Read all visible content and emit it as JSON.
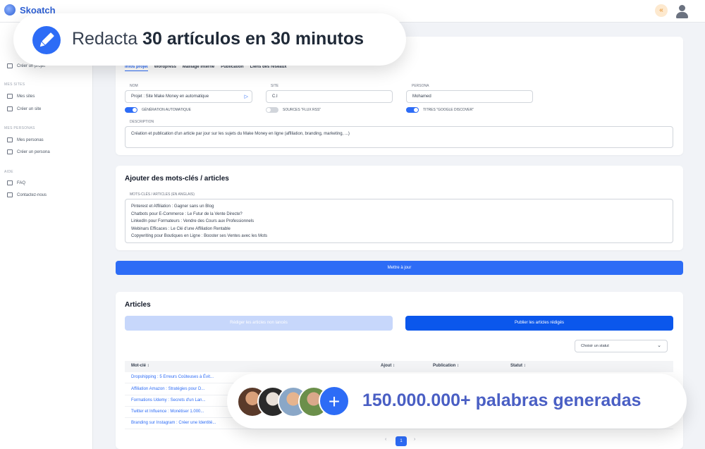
{
  "app": {
    "name": "Skoatch"
  },
  "sidebar": {
    "sections": [
      {
        "label": "MES SITES",
        "items": [
          {
            "label": "Mes sites"
          },
          {
            "label": "Créer un site"
          }
        ]
      },
      {
        "label": "MES PERSONAS",
        "items": [
          {
            "label": "Mes personas"
          },
          {
            "label": "Créer un persona"
          }
        ]
      },
      {
        "label": "AIDE",
        "items": [
          {
            "label": "FAQ"
          },
          {
            "label": "Contactez-nous"
          }
        ]
      }
    ],
    "top_item": "Créer un projet"
  },
  "project": {
    "tabs": [
      "Infos projet",
      "Wordpress",
      "Maillage interne",
      "Publication",
      "Liens des réseaux"
    ],
    "fields": {
      "nom": {
        "label": "NOM",
        "value": "Projet : Site Make Money en automatique"
      },
      "site": {
        "label": "SITE",
        "value": "C.I"
      },
      "persona": {
        "label": "PERSONA",
        "value": "Mohamed"
      }
    },
    "toggles": [
      {
        "label": "GÉNÉRATION AUTOMATIQUE",
        "on": true
      },
      {
        "label": "SOURCES \"FLUX RSS\"",
        "on": false
      },
      {
        "label": "TITRES \"GOOGLE DISCOVER\"",
        "on": true
      }
    ],
    "description": {
      "label": "DESCRIPTION",
      "value": "Création et publication d'un article par jour sur les sujets du Make Money en ligne (affiliation, branding, marketing, ...)"
    }
  },
  "keywords": {
    "title": "Ajouter des mots-clés / articles",
    "label": "MOTS-CLÉS / ARTICLES (EN ANGLAIS)",
    "lines": [
      "Pinterest et Affiliation : Gagner sans un Blog",
      "Chatbots pour E-Commerce : Le Futur de la Vente Directe?",
      "LinkedIn pour Formateurs : Vendre des Cours aux Professionnels",
      "Webinars Efficaces : Le Clé d'une Affiliation Rentable",
      "Copywriting pour Boutiques en Ligne : Booster ses Ventes avec les Mots"
    ],
    "update_button": "Mettre à jour"
  },
  "articles": {
    "title": "Articles",
    "create_button": "Rédiger les articles non lancés",
    "publish_button": "Publier les articles rédigés",
    "status_select": "Choisir un statut",
    "columns": [
      "Mot-clé ↕",
      "Ajout ↕",
      "Publication ↕",
      "Statut ↕"
    ],
    "rows": [
      "Dropshipping : 5 Erreurs Coûteuses à Évit...",
      "Affiliation Amazon : Stratégies pour D...",
      "Formations Udemy : Secrets d'un Lan...",
      "Twitter et Influence : Monétiser 1.000...",
      "Branding sur Instagram : Créer une Identité..."
    ],
    "pagination": {
      "prev": "‹",
      "current": "1",
      "next": "›"
    }
  },
  "promo": {
    "top_prefix": "Redacta ",
    "top_bold": "30 artículos en 30 minutos",
    "bottom_text": "150.000.000+ palabras generadas",
    "plus": "+"
  },
  "colors": {
    "primary": "#2d6cf6",
    "publish": "#0b57ec",
    "disabled": "#c7d7fb",
    "accent": "#4a5fc4"
  }
}
